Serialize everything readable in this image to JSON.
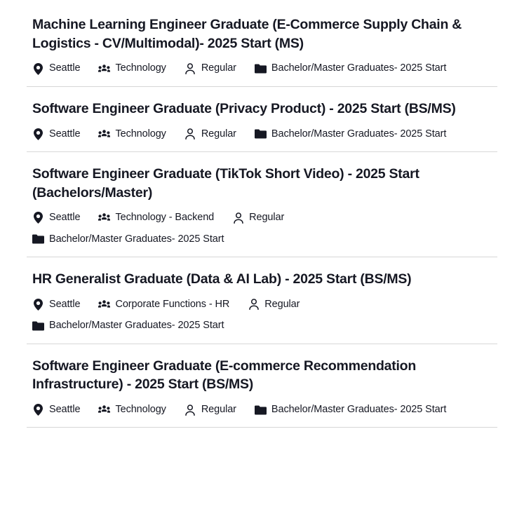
{
  "page": {
    "background_color": "#ffffff",
    "text_color": "#161823",
    "divider_color": "#d7d7d7"
  },
  "icons": {
    "location": "location-pin-icon",
    "department": "people-group-icon",
    "employment_type": "person-icon",
    "job_category": "folder-icon"
  },
  "jobs": [
    {
      "title": "Machine Learning Engineer Graduate (E-Commerce Supply Chain & Logistics - CV/Multimodal)- 2025 Start (MS)",
      "location": "Seattle",
      "department": "Technology",
      "employment_type": "Regular",
      "job_category": "Bachelor/Master Graduates- 2025 Start",
      "meta_wraps": false
    },
    {
      "title": "Software Engineer Graduate (Privacy Product) - 2025 Start (BS/MS)",
      "location": "Seattle",
      "department": "Technology",
      "employment_type": "Regular",
      "job_category": "Bachelor/Master Graduates- 2025 Start",
      "meta_wraps": false
    },
    {
      "title": "Software Engineer Graduate (TikTok Short Video) - 2025 Start (Bachelors/Master)",
      "location": "Seattle",
      "department": "Technology - Backend",
      "employment_type": "Regular",
      "job_category": "Bachelor/Master Graduates- 2025 Start",
      "meta_wraps": true
    },
    {
      "title": "HR Generalist Graduate (Data & AI Lab) - 2025 Start (BS/MS)",
      "location": "Seattle",
      "department": "Corporate Functions - HR",
      "employment_type": "Regular",
      "job_category": "Bachelor/Master Graduates- 2025 Start",
      "meta_wraps": true
    },
    {
      "title": "Software Engineer Graduate (E-commerce Recommendation Infrastructure) - 2025 Start (BS/MS)",
      "location": "Seattle",
      "department": "Technology",
      "employment_type": "Regular",
      "job_category": "Bachelor/Master Graduates- 2025 Start",
      "meta_wraps": false
    }
  ]
}
